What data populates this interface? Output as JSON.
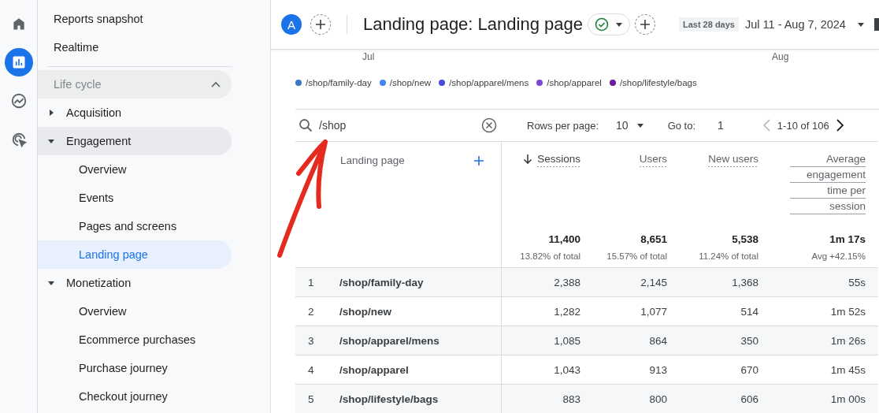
{
  "rail": {
    "items": [
      {
        "kind": "home",
        "selected": false
      },
      {
        "kind": "reports",
        "selected": true
      },
      {
        "kind": "explore",
        "selected": false
      },
      {
        "kind": "advertising",
        "selected": false
      }
    ]
  },
  "sidebar": {
    "top_items": [
      "Reports snapshot",
      "Realtime"
    ],
    "section": {
      "label": "Life cycle",
      "expanded": true
    },
    "items": [
      {
        "label": "Acquisition",
        "expanded": false,
        "selected": false
      },
      {
        "label": "Engagement",
        "expanded": true,
        "selected": true,
        "children": [
          {
            "label": "Overview",
            "selected": false
          },
          {
            "label": "Events",
            "selected": false
          },
          {
            "label": "Pages and screens",
            "selected": false
          },
          {
            "label": "Landing page",
            "selected": true
          }
        ]
      },
      {
        "label": "Monetization",
        "expanded": true,
        "selected": false,
        "children": [
          {
            "label": "Overview",
            "selected": false
          },
          {
            "label": "Ecommerce purchases",
            "selected": false
          },
          {
            "label": "Purchase journey",
            "selected": false
          },
          {
            "label": "Checkout journey",
            "selected": false
          }
        ]
      }
    ]
  },
  "header": {
    "avatar": "A",
    "title": "Landing page: Landing page",
    "range_chip": "Last 28 days",
    "date_range": "Jul 11 - Aug 7, 2024"
  },
  "x_axis_months": [
    {
      "label": "Jul"
    },
    {
      "label": "Aug"
    }
  ],
  "legend": [
    {
      "label": "/shop/family-day",
      "color": "#3b78c4"
    },
    {
      "label": "/shop/new",
      "color": "#4285f4"
    },
    {
      "label": "/shop/apparel/mens",
      "color": "#4a4ae0"
    },
    {
      "label": "/shop/apparel",
      "color": "#7e45d6"
    },
    {
      "label": "/shop/lifestyle/bags",
      "color": "#6a1b9a"
    }
  ],
  "toolbar": {
    "search_value": "/shop",
    "rows_per_page_label": "Rows per page:",
    "rows_per_page": "10",
    "goto_label": "Go to:",
    "goto_value": "1",
    "range": "1-10 of 106"
  },
  "table": {
    "first_column": "Landing page",
    "columns": [
      {
        "label": "Sessions",
        "sorted": true,
        "total": "11,400",
        "share": "13.82% of total"
      },
      {
        "label": "Users",
        "sorted": false,
        "total": "8,651",
        "share": "15.57% of total"
      },
      {
        "label": "New users",
        "sorted": false,
        "total": "5,538",
        "share": "11.24% of total"
      },
      {
        "label": "Average engagement time per session",
        "sorted": false,
        "total": "1m 17s",
        "share": "Avg +42.15%"
      }
    ],
    "rows": [
      {
        "index": "1",
        "page": "/shop/family-day",
        "values": [
          "2,388",
          "2,145",
          "1,368",
          "55s"
        ]
      },
      {
        "index": "2",
        "page": "/shop/new",
        "values": [
          "1,282",
          "1,077",
          "514",
          "1m 52s"
        ]
      },
      {
        "index": "3",
        "page": "/shop/apparel/mens",
        "values": [
          "1,085",
          "864",
          "350",
          "1m 26s"
        ]
      },
      {
        "index": "4",
        "page": "/shop/apparel",
        "values": [
          "1,043",
          "913",
          "670",
          "1m 45s"
        ]
      },
      {
        "index": "5",
        "page": "/shop/lifestyle/bags",
        "values": [
          "883",
          "800",
          "606",
          "1m 00s"
        ]
      }
    ]
  }
}
